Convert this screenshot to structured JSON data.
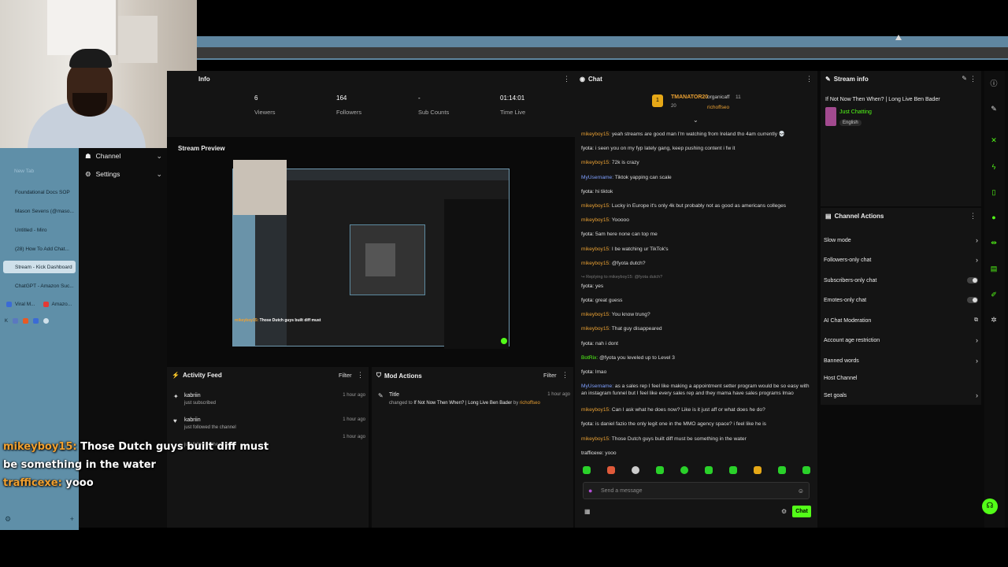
{
  "browser": {
    "new_tab": "New Tab",
    "tabs": [
      {
        "label": "Foundational Docs SOP",
        "color": "#3b6bd6"
      },
      {
        "label": "Mason Sevens (@maso...",
        "color": "#111111"
      },
      {
        "label": "Untitled - Miro",
        "color": "#f5c400"
      },
      {
        "label": "(28) How To Add Chat...",
        "color": "#e53935"
      },
      {
        "label": "Stream - Kick Dashboard",
        "color": "#53fc18"
      },
      {
        "label": "ChatGPT - Amazon Suc...",
        "color": "#10a37f"
      }
    ],
    "mini_tabs": [
      "Viral M...",
      "Amazo..."
    ]
  },
  "sidebar": {
    "items": [
      {
        "label": "Channel"
      },
      {
        "label": "Settings"
      }
    ]
  },
  "overlay_chat": [
    {
      "user": "mikeyboy15:",
      "text": " Those Dutch guys built diff must"
    },
    {
      "user": "",
      "text": "be something in the water"
    },
    {
      "user": "trafficexe:",
      "text": " yooo"
    }
  ],
  "info": {
    "title": "Info",
    "stats": [
      {
        "value": "6",
        "label": "Viewers"
      },
      {
        "value": "164",
        "label": "Followers"
      },
      {
        "value": "-",
        "label": "Sub Counts"
      },
      {
        "value": "01:14:01",
        "label": "Time Live"
      }
    ]
  },
  "preview": {
    "title": "Stream Preview"
  },
  "activity": {
    "title": "Activity Feed",
    "filter": "Filter",
    "items": [
      {
        "user": "kabriin",
        "action": "just subscribed",
        "time": "1 hour ago"
      },
      {
        "user": "kabriin",
        "action": "just followed the channel",
        "time": "1 hour ago"
      },
      {
        "user": "",
        "action": "just followed the channel",
        "time": "1 hour ago"
      }
    ]
  },
  "mod": {
    "title": "Mod Actions",
    "filter": "Filter",
    "item": {
      "label": "Title",
      "changed": "changed to",
      "value": "If Not Now Then When? | Long Live Ben Bader",
      "by": "by",
      "who": "richoffseo",
      "time": "1 hour ago"
    }
  },
  "chat": {
    "title": "Chat",
    "pinned_users": [
      {
        "name": "TMANATOR20",
        "count": "20"
      },
      {
        "name": "organicaff",
        "count": "11"
      },
      {
        "name": "richoffseo",
        "count": ""
      }
    ],
    "messages": [
      {
        "user": "mikeyboy15:",
        "cls": "u1",
        "text": " yeah streams are good man I'm watching from Ireland tho 4am currently 💀"
      },
      {
        "user": "fyota:",
        "cls": "u2",
        "text": " i seen you on my fyp lately gang, keep pushing content i fw it"
      },
      {
        "user": "mikeyboy15:",
        "cls": "u1",
        "text": " 72k is crazy"
      },
      {
        "user": "MyUsername:",
        "cls": "u3",
        "text": " Tiktok yapping can scale"
      },
      {
        "user": "fyota:",
        "cls": "u2",
        "text": " hi tiktok"
      },
      {
        "user": "mikeyboy15:",
        "cls": "u1",
        "text": " Lucky in Europe it's only 4k but probably not as good as americans colleges"
      },
      {
        "user": "mikeyboy15:",
        "cls": "u1",
        "text": " Yooooo"
      },
      {
        "user": "fyota:",
        "cls": "u2",
        "text": " 5am here none can top me"
      },
      {
        "user": "mikeyboy15:",
        "cls": "u1",
        "text": " I be watching ur TikTok's"
      },
      {
        "user": "mikeyboy15:",
        "cls": "u1",
        "text": " @fyota dutch?"
      },
      {
        "user": "",
        "cls": "reply",
        "text": "↪ Replying to mikeyboy15: @fyota dutch?"
      },
      {
        "user": "fyota:",
        "cls": "u2",
        "text": " yes"
      },
      {
        "user": "fyota:",
        "cls": "u2",
        "text": " great guess"
      },
      {
        "user": "mikeyboy15:",
        "cls": "u1",
        "text": " You know trung?"
      },
      {
        "user": "mikeyboy15:",
        "cls": "u1",
        "text": " That guy disappeared"
      },
      {
        "user": "fyota:",
        "cls": "u2",
        "text": " nah i dont"
      },
      {
        "user": "BotRix:",
        "cls": "u4",
        "text": " @fyota you leveled up to Level 3"
      },
      {
        "user": "fyota:",
        "cls": "u2",
        "text": " lmao"
      },
      {
        "user": "MyUsername:",
        "cls": "u3",
        "text": " as a sales rep I feel like making a appointment setter program would be so easy with an instagram funnel but I feel like every sales rep and they mama have sales programs lmao",
        "two": true
      },
      {
        "user": "mikeyboy15:",
        "cls": "u1",
        "text": " Can I ask what he does now? Like is it just aff or what does he do?"
      },
      {
        "user": "fyota:",
        "cls": "u2",
        "text": " is daniel fazio the only legit one in the MMO agency space? i feel like he is"
      },
      {
        "user": "mikeyboy15:",
        "cls": "u1",
        "text": " Those Dutch guys built diff must be something in the water"
      },
      {
        "user": "trafficexe:",
        "cls": "u2",
        "text": " yooo"
      }
    ],
    "input_placeholder": "Send a message",
    "send_label": "Chat"
  },
  "stream_info": {
    "title": "Stream info",
    "stream_title": "If Not Now Then When? | Long Live Ben Bader",
    "category": "Just Chatting",
    "language": "English"
  },
  "channel_actions": {
    "title": "Channel Actions",
    "items": [
      {
        "label": "Slow mode",
        "kind": "chevron"
      },
      {
        "label": "Followers-only chat",
        "kind": "chevron"
      },
      {
        "label": "Subscribers-only chat",
        "kind": "toggle"
      },
      {
        "label": "Emotes-only chat",
        "kind": "toggle"
      },
      {
        "label": "AI Chat Moderation",
        "kind": "external"
      },
      {
        "label": "Account age restriction",
        "kind": "chevron"
      },
      {
        "label": "Banned words",
        "kind": "chevron"
      },
      {
        "label": "Host Channel",
        "kind": "none"
      },
      {
        "label": "Set goals",
        "kind": "chevron"
      }
    ]
  },
  "colors": {
    "accent": "#53fc18",
    "username_orange": "#e9a033",
    "sidebar_blue": "#5f8fa8"
  }
}
